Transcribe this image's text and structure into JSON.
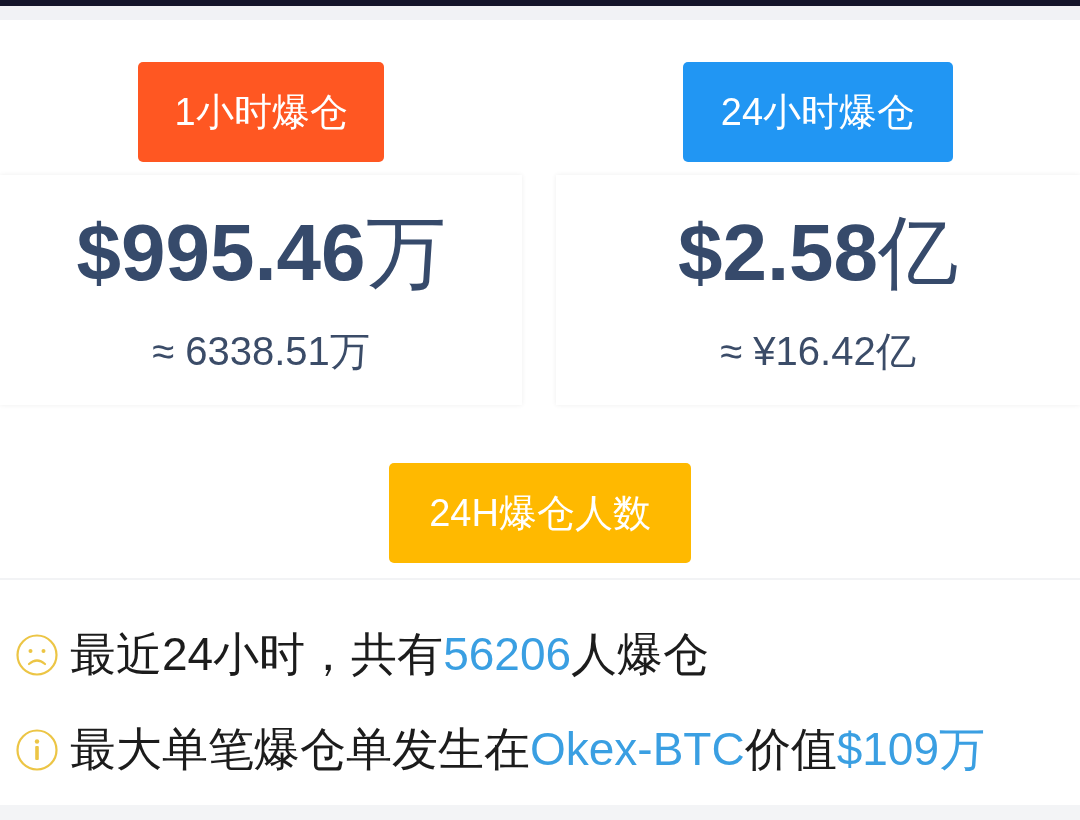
{
  "cards": [
    {
      "label": "1小时爆仓",
      "color": "#ff5722",
      "amount": "**$995.46**万",
      "converted": "≈ 6338.51万"
    },
    {
      "label": "24小时爆仓",
      "color": "#2196f3",
      "amount": "**$2.58**亿",
      "converted": "≈ ¥16.42亿"
    }
  ],
  "people": {
    "label": "24H爆仓人数",
    "color": "#ffb900"
  },
  "facts": [
    {
      "kind": "sad",
      "segments": [
        {
          "text": "最近24小时，共有",
          "highlight": false
        },
        {
          "text": "56206",
          "highlight": true
        },
        {
          "text": "人爆仓",
          "highlight": false
        }
      ]
    },
    {
      "kind": "info",
      "segments": [
        {
          "text": "最大单笔爆仓单发生在",
          "highlight": false
        },
        {
          "text": "Okex-BTC",
          "highlight": true
        },
        {
          "text": "价值",
          "highlight": false
        },
        {
          "text": "$109万",
          "highlight": true
        }
      ]
    }
  ]
}
